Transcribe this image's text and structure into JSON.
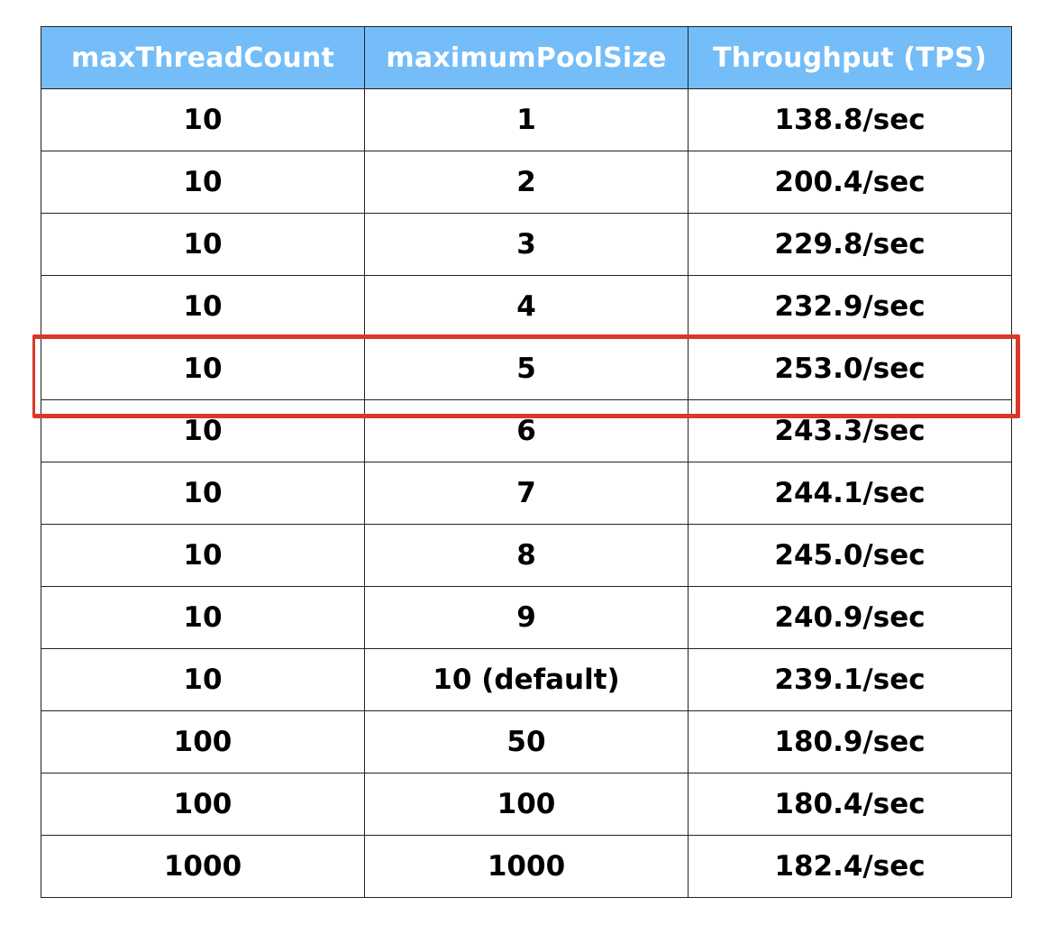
{
  "table": {
    "headers": [
      "maxThreadCount",
      "maximumPoolSize",
      "Throughput (TPS)"
    ],
    "rows": [
      [
        "10",
        "1",
        "138.8/sec"
      ],
      [
        "10",
        "2",
        "200.4/sec"
      ],
      [
        "10",
        "3",
        "229.8/sec"
      ],
      [
        "10",
        "4",
        "232.9/sec"
      ],
      [
        "10",
        "5",
        "253.0/sec"
      ],
      [
        "10",
        "6",
        "243.3/sec"
      ],
      [
        "10",
        "7",
        "244.1/sec"
      ],
      [
        "10",
        "8",
        "245.0/sec"
      ],
      [
        "10",
        "9",
        "240.9/sec"
      ],
      [
        "10",
        "10 (default)",
        "239.1/sec"
      ],
      [
        "100",
        "50",
        "180.9/sec"
      ],
      [
        "100",
        "100",
        "180.4/sec"
      ],
      [
        "1000",
        "1000",
        "182.4/sec"
      ]
    ],
    "highlighted_row_index": 4
  },
  "colors": {
    "header_background": "#74bdf8",
    "header_text": "#ffffff",
    "highlight_outline": "#d9382a",
    "grid_line": "#222222"
  },
  "chart_data": {
    "type": "table",
    "columns": [
      "maxThreadCount",
      "maximumPoolSize",
      "Throughput (TPS)"
    ],
    "rows": [
      {
        "maxThreadCount": 10,
        "maximumPoolSize": "1",
        "throughput": 138.8
      },
      {
        "maxThreadCount": 10,
        "maximumPoolSize": "2",
        "throughput": 200.4
      },
      {
        "maxThreadCount": 10,
        "maximumPoolSize": "3",
        "throughput": 229.8
      },
      {
        "maxThreadCount": 10,
        "maximumPoolSize": "4",
        "throughput": 232.9
      },
      {
        "maxThreadCount": 10,
        "maximumPoolSize": "5",
        "throughput": 253.0
      },
      {
        "maxThreadCount": 10,
        "maximumPoolSize": "6",
        "throughput": 243.3
      },
      {
        "maxThreadCount": 10,
        "maximumPoolSize": "7",
        "throughput": 244.1
      },
      {
        "maxThreadCount": 10,
        "maximumPoolSize": "8",
        "throughput": 245.0
      },
      {
        "maxThreadCount": 10,
        "maximumPoolSize": "9",
        "throughput": 240.9
      },
      {
        "maxThreadCount": 10,
        "maximumPoolSize": "10 (default)",
        "throughput": 239.1
      },
      {
        "maxThreadCount": 100,
        "maximumPoolSize": "50",
        "throughput": 180.9
      },
      {
        "maxThreadCount": 100,
        "maximumPoolSize": "100",
        "throughput": 180.4
      },
      {
        "maxThreadCount": 1000,
        "maximumPoolSize": "1000",
        "throughput": 182.4
      }
    ]
  }
}
